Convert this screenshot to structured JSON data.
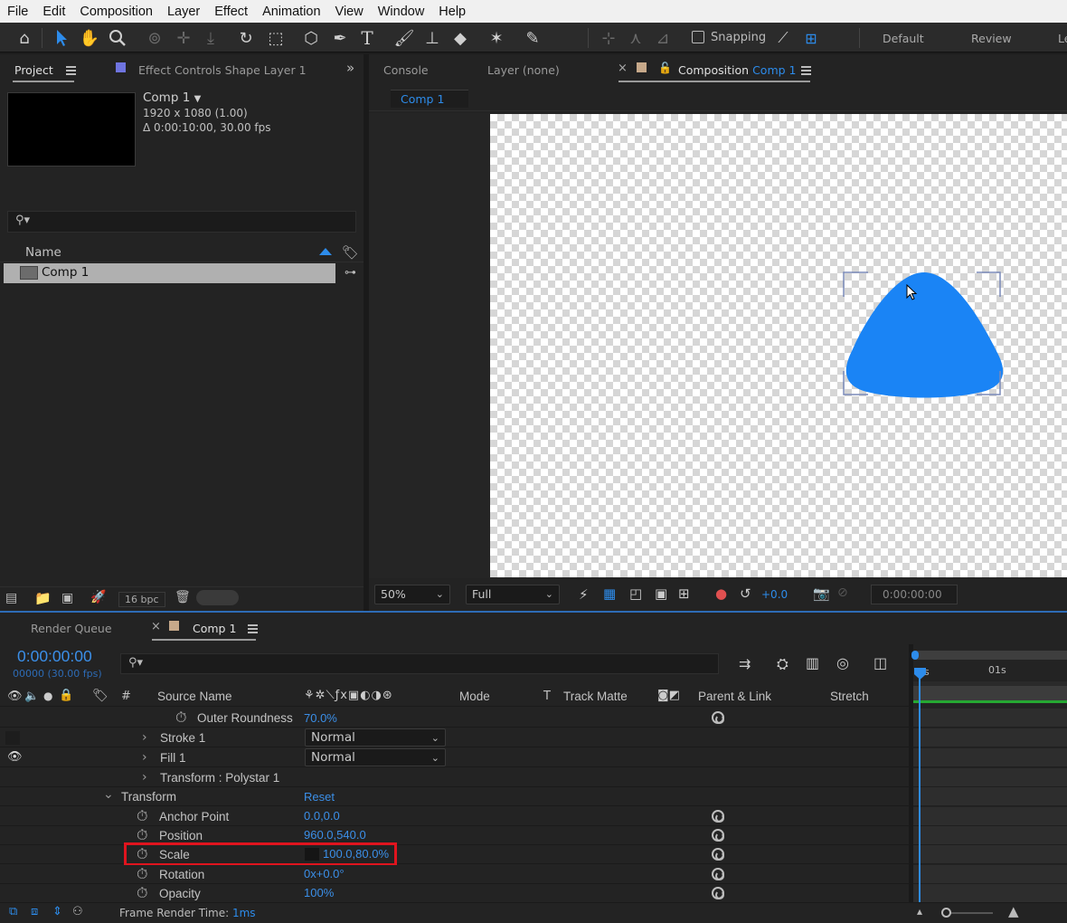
{
  "menu": [
    "File",
    "Edit",
    "Composition",
    "Layer",
    "Effect",
    "Animation",
    "View",
    "Window",
    "Help"
  ],
  "toolbar": {
    "snapping_label": "Snapping",
    "workspaces": [
      "Default",
      "Review",
      "Le"
    ]
  },
  "project_panel": {
    "tab_project": "Project",
    "tab_effect_controls": "Effect Controls",
    "effect_controls_layer": "Shape Layer 1",
    "comp_name": "Comp 1",
    "comp_dims": "1920 x 1080 (1.00)",
    "comp_duration": "Δ 0:00:10:00, 30.00 fps",
    "search_placeholder": "",
    "column_name": "Name",
    "items": [
      "Comp 1"
    ],
    "bpc": "16 bpc"
  },
  "viewer_panel": {
    "tab_console": "Console",
    "tab_layer": "Layer (none)",
    "tab_composition_prefix": "Composition",
    "tab_composition_name": "Comp 1",
    "breadcrumb": "Comp 1",
    "zoom": "50%",
    "resolution": "Full",
    "exposure": "+0.0",
    "timecode": "0:00:00:00",
    "shape_color": "#1a84f5"
  },
  "timeline": {
    "tab_render_queue": "Render Queue",
    "tab_comp": "Comp 1",
    "timecode": "0:00:00:00",
    "frame_info": "00000 (30.00 fps)",
    "columns": {
      "hash": "#",
      "source_name": "Source Name",
      "mode": "Mode",
      "t": "T",
      "track_matte": "Track Matte",
      "parent_link": "Parent & Link",
      "stretch": "Stretch"
    },
    "ruler": [
      "0s",
      "01s"
    ],
    "rows": [
      {
        "label": "Outer Roundness",
        "value": "70.0%"
      },
      {
        "label": "Stroke 1",
        "mode": "Normal"
      },
      {
        "label": "Fill 1",
        "mode": "Normal"
      },
      {
        "label": "Transform : Polystar 1"
      },
      {
        "label": "Transform",
        "value": "Reset"
      },
      {
        "label": "Anchor Point",
        "value": "0.0,0.0"
      },
      {
        "label": "Position",
        "value": "960.0,540.0"
      },
      {
        "label": "Scale",
        "value": "100.0,80.0%"
      },
      {
        "label": "Rotation",
        "value": "0x+0.0°"
      },
      {
        "label": "Opacity",
        "value": "100%"
      }
    ],
    "footer_label": "Frame Render Time:",
    "footer_value": "1ms",
    "highlight_color": "#e0141e"
  }
}
